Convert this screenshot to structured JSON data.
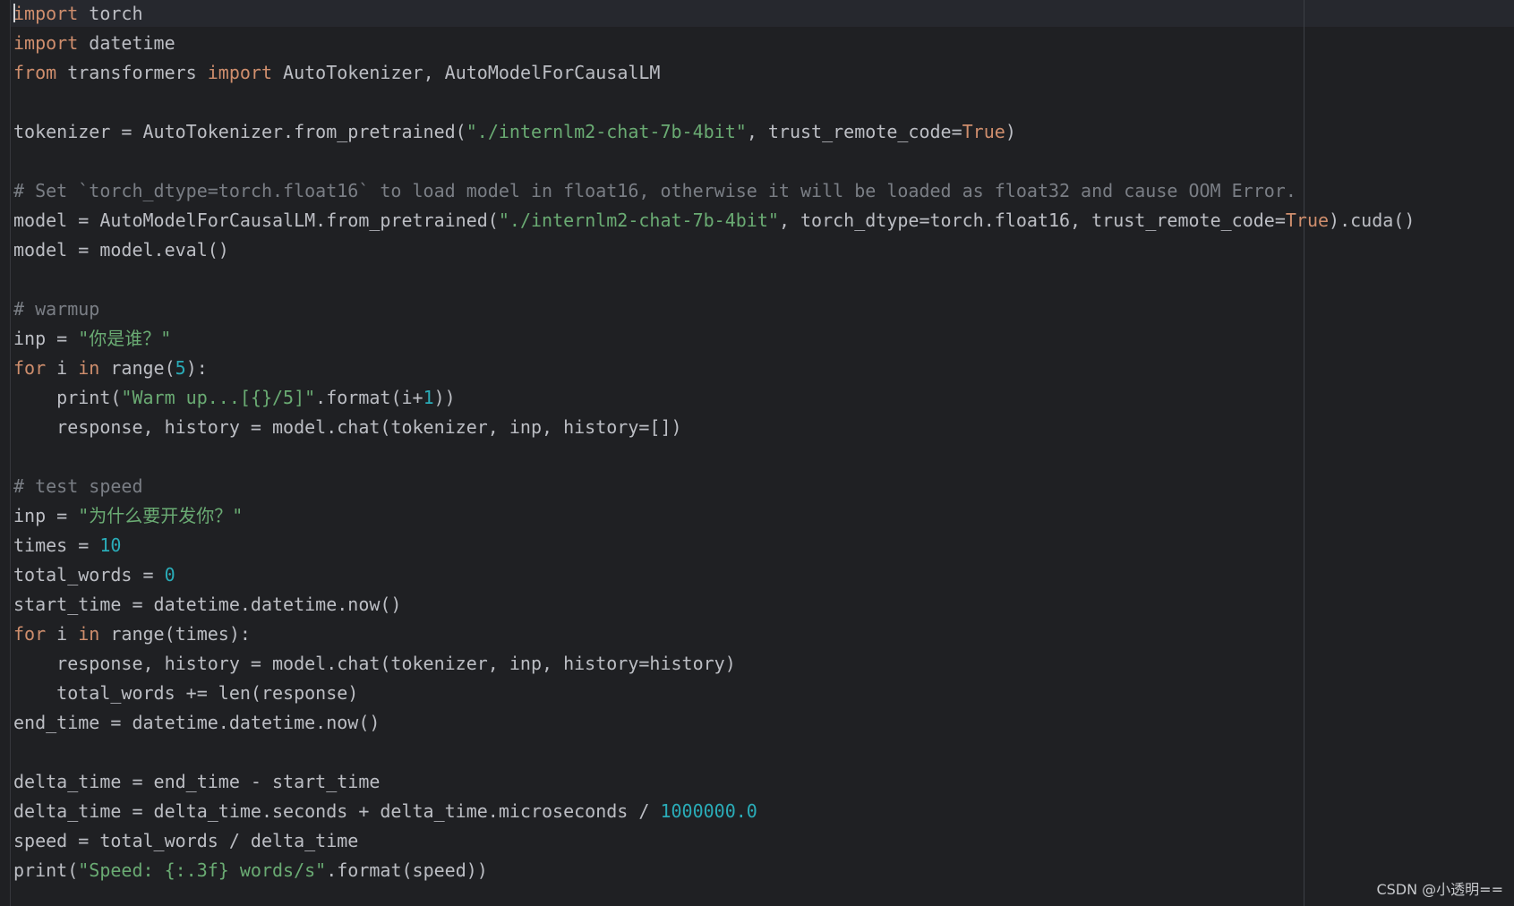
{
  "editor": {
    "language": "python",
    "lines": [
      [
        {
          "t": "import",
          "c": "kw"
        },
        {
          "t": " torch",
          "c": "plain"
        }
      ],
      [
        {
          "t": "import",
          "c": "kw"
        },
        {
          "t": " datetime",
          "c": "plain"
        }
      ],
      [
        {
          "t": "from",
          "c": "kw"
        },
        {
          "t": " transformers ",
          "c": "plain"
        },
        {
          "t": "import",
          "c": "kw"
        },
        {
          "t": " AutoTokenizer, AutoModelForCausalLM",
          "c": "plain"
        }
      ],
      [],
      [
        {
          "t": "tokenizer = AutoTokenizer.from_pretrained(",
          "c": "plain"
        },
        {
          "t": "\"./internlm2-chat-7b-4bit\"",
          "c": "str"
        },
        {
          "t": ", trust_remote_code=",
          "c": "plain"
        },
        {
          "t": "True",
          "c": "kw"
        },
        {
          "t": ")",
          "c": "plain"
        }
      ],
      [],
      [
        {
          "t": "# Set `torch_dtype=torch.float16` to load model in float16, otherwise it will be loaded as float32 and cause OOM Error.",
          "c": "com"
        }
      ],
      [
        {
          "t": "model = AutoModelForCausalLM.from_pretrained(",
          "c": "plain"
        },
        {
          "t": "\"./internlm2-chat-7b-4bit\"",
          "c": "str"
        },
        {
          "t": ", torch_dtype=torch.float16, trust_remote_code=",
          "c": "plain"
        },
        {
          "t": "True",
          "c": "kw"
        },
        {
          "t": ").cuda()",
          "c": "plain"
        }
      ],
      [
        {
          "t": "model = model.eval()",
          "c": "plain"
        }
      ],
      [],
      [
        {
          "t": "# warmup",
          "c": "com"
        }
      ],
      [
        {
          "t": "inp = ",
          "c": "plain"
        },
        {
          "t": "\"你是谁？\"",
          "c": "str"
        }
      ],
      [
        {
          "t": "for",
          "c": "kw"
        },
        {
          "t": " i ",
          "c": "plain"
        },
        {
          "t": "in",
          "c": "kw"
        },
        {
          "t": " range(",
          "c": "plain"
        },
        {
          "t": "5",
          "c": "num"
        },
        {
          "t": "):",
          "c": "plain"
        }
      ],
      [
        {
          "t": "    print(",
          "c": "plain"
        },
        {
          "t": "\"Warm up...[{}/5]\"",
          "c": "str"
        },
        {
          "t": ".format(i+",
          "c": "plain"
        },
        {
          "t": "1",
          "c": "num"
        },
        {
          "t": "))",
          "c": "plain"
        }
      ],
      [
        {
          "t": "    response, history = model.chat(tokenizer, inp, history=[])",
          "c": "plain"
        }
      ],
      [],
      [
        {
          "t": "# test speed",
          "c": "com"
        }
      ],
      [
        {
          "t": "inp = ",
          "c": "plain"
        },
        {
          "t": "\"为什么要开发你？\"",
          "c": "str"
        }
      ],
      [
        {
          "t": "times = ",
          "c": "plain"
        },
        {
          "t": "10",
          "c": "num"
        }
      ],
      [
        {
          "t": "total_words = ",
          "c": "plain"
        },
        {
          "t": "0",
          "c": "num"
        }
      ],
      [
        {
          "t": "start_time = datetime.datetime.now()",
          "c": "plain"
        }
      ],
      [
        {
          "t": "for",
          "c": "kw"
        },
        {
          "t": " i ",
          "c": "plain"
        },
        {
          "t": "in",
          "c": "kw"
        },
        {
          "t": " range(times):",
          "c": "plain"
        }
      ],
      [
        {
          "t": "    response, history = model.chat(tokenizer, inp, history=history)",
          "c": "plain"
        }
      ],
      [
        {
          "t": "    total_words += len(response)",
          "c": "plain"
        }
      ],
      [
        {
          "t": "end_time = datetime.datetime.now()",
          "c": "plain"
        }
      ],
      [],
      [
        {
          "t": "delta_time = end_time - start_time",
          "c": "plain"
        }
      ],
      [
        {
          "t": "delta_time = delta_time.seconds + delta_time.microseconds / ",
          "c": "plain"
        },
        {
          "t": "1000000.0",
          "c": "num"
        }
      ],
      [
        {
          "t": "speed = total_words / delta_time",
          "c": "plain"
        }
      ],
      [
        {
          "t": "print(",
          "c": "plain"
        },
        {
          "t": "\"Speed: {:.3f} words/s\"",
          "c": "str"
        },
        {
          "t": ".format(speed))",
          "c": "plain"
        }
      ]
    ]
  },
  "colors": {
    "background": "#1f2023",
    "keyword": "#cf8e6d",
    "string": "#6aab73",
    "number": "#2aacb8",
    "comment": "#7a7e85",
    "text": "#bcbec4"
  },
  "watermark": "CSDN @小透明=="
}
